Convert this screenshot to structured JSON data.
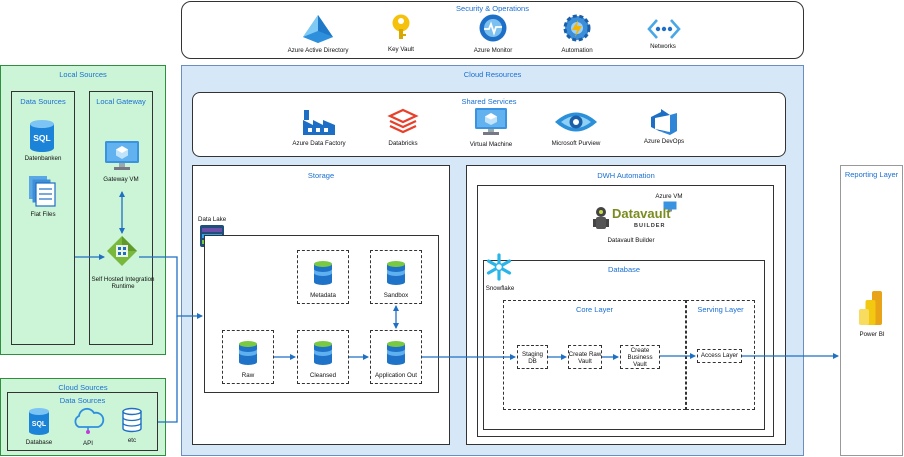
{
  "security": {
    "title": "Security & Operations",
    "items": [
      "Azure Active Directory",
      "Key Vault",
      "Azure Monitor",
      "Automation",
      "Networks"
    ]
  },
  "local_sources": {
    "title": "Local Sources",
    "data_sources": {
      "title": "Data Sources",
      "items": [
        "Datenbanken",
        "Flat Files"
      ],
      "sql_text": "SQL"
    },
    "local_gateway": {
      "title": "Local Gateway",
      "items": [
        "Gateway VM",
        "Self Hosted Integration Runtime"
      ]
    }
  },
  "cloud_sources": {
    "title": "Cloud Sources",
    "data_sources_title": "Data Sources",
    "items": [
      "Database",
      "API",
      "etc"
    ],
    "sql_text": "SQL"
  },
  "cloud_resources": {
    "title": "Cloud Resources",
    "shared_services": {
      "title": "Shared Services",
      "items": [
        "Azure Data Factory",
        "Databricks",
        "Virtual Machine",
        "Microsoft Purview",
        "Azure DevOps"
      ]
    },
    "storage": {
      "title": "Storage",
      "data_lake": "Data Lake",
      "layers": [
        "Metadata",
        "Sandbox",
        "Raw",
        "Cleansed",
        "Application Out"
      ]
    },
    "dwh_automation": {
      "title": "DWH Automation",
      "azure_vm": "Azure VM",
      "datavault_logo": "Datavault",
      "datavault_logo_sub": "BUILDER",
      "datavault_builder": "Datavault Builder",
      "database": {
        "title": "Database",
        "snowflake": "Snowflake",
        "core_layer": {
          "title": "Core Layer",
          "steps": [
            "Staging DB",
            "Create Raw Vault",
            "Create Business Vault"
          ]
        },
        "serving_layer": {
          "title": "Serving Layer",
          "steps": [
            "Access Layer"
          ]
        }
      }
    }
  },
  "reporting": {
    "title": "Reporting Layer",
    "items": [
      "Power BI"
    ]
  },
  "colors": {
    "title_blue": "#1a6fd1",
    "arrow_blue": "#1f6fc2",
    "local_fill": "#ccf5d8",
    "local_border": "#2f8f3f",
    "cloud_fill": "#d6e8f8",
    "cloud_border": "#6c8ebf"
  }
}
